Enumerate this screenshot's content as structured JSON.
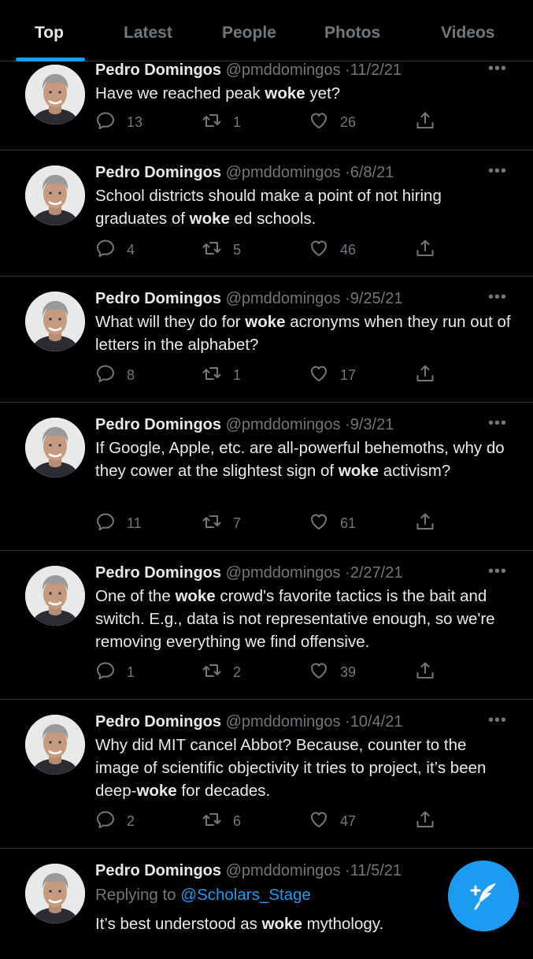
{
  "tabs": [
    {
      "label": "Top",
      "active": true
    },
    {
      "label": "Latest",
      "active": false
    },
    {
      "label": "People",
      "active": false
    },
    {
      "label": "Photos",
      "active": false
    },
    {
      "label": "Videos",
      "active": false
    }
  ],
  "tweets": [
    {
      "name": "Pedro Domingos",
      "handle": "@pmddomingos",
      "sep": "·",
      "date": "11/2/21",
      "text": [
        "Have we reached peak ",
        "woke",
        " yet?"
      ],
      "reply": "13",
      "retweet": "1",
      "like": "26"
    },
    {
      "name": "Pedro Domingos",
      "handle": "@pmddomingos",
      "sep": "·",
      "date": "6/8/21",
      "text": [
        "School districts should make a point of not hiring graduates of ",
        "woke",
        " ed schools."
      ],
      "reply": "4",
      "retweet": "5",
      "like": "46"
    },
    {
      "name": "Pedro Domingos",
      "handle": "@pmddomingos",
      "sep": "·",
      "date": "9/25/21",
      "text": [
        "What will they do for ",
        "woke",
        " acronyms when they run out of letters in the alphabet?"
      ],
      "reply": "8",
      "retweet": "1",
      "like": "17"
    },
    {
      "name": "Pedro Domingos",
      "handle": "@pmddomingos",
      "sep": "·",
      "date": "9/3/21",
      "text": [
        "If Google, Apple, etc. are all-powerful behemoths, why do they cower at the slightest sign of ",
        "woke",
        " activism?"
      ],
      "reply": "11",
      "retweet": "7",
      "like": "61"
    },
    {
      "name": "Pedro Domingos",
      "handle": "@pmddomingos",
      "sep": "·",
      "date": "2/27/21",
      "text": [
        "One of the ",
        "woke",
        " crowd's favorite tactics is the bait and switch. E.g., data is not representative enough, so we're removing everything we find offensive."
      ],
      "reply": "1",
      "retweet": "2",
      "like": "39"
    },
    {
      "name": "Pedro Domingos",
      "handle": "@pmddomingos",
      "sep": "·",
      "date": "10/4/21",
      "text": [
        "Why did MIT cancel Abbot? Because, counter to the image of scientific objectivity it tries to project, it’s been deep-",
        "woke",
        " for decades."
      ],
      "reply": "2",
      "retweet": "6",
      "like": "47"
    },
    {
      "name": "Pedro Domingos",
      "handle": "@pmddomingos",
      "sep": "·",
      "date": "11/5/21",
      "replying_label": "Replying to",
      "replying_to": "@Scholars_Stage",
      "text": [
        "It’s best understood as ",
        "woke",
        " mythology."
      ]
    }
  ],
  "icons": {
    "more": "more-horizontal-icon",
    "reply": "reply-icon",
    "retweet": "retweet-icon",
    "like": "heart-icon",
    "share": "share-icon",
    "compose": "compose-feather-icon"
  },
  "colors": {
    "accent": "#1d9bf0",
    "background": "#000000",
    "secondary_text": "#71767b"
  }
}
